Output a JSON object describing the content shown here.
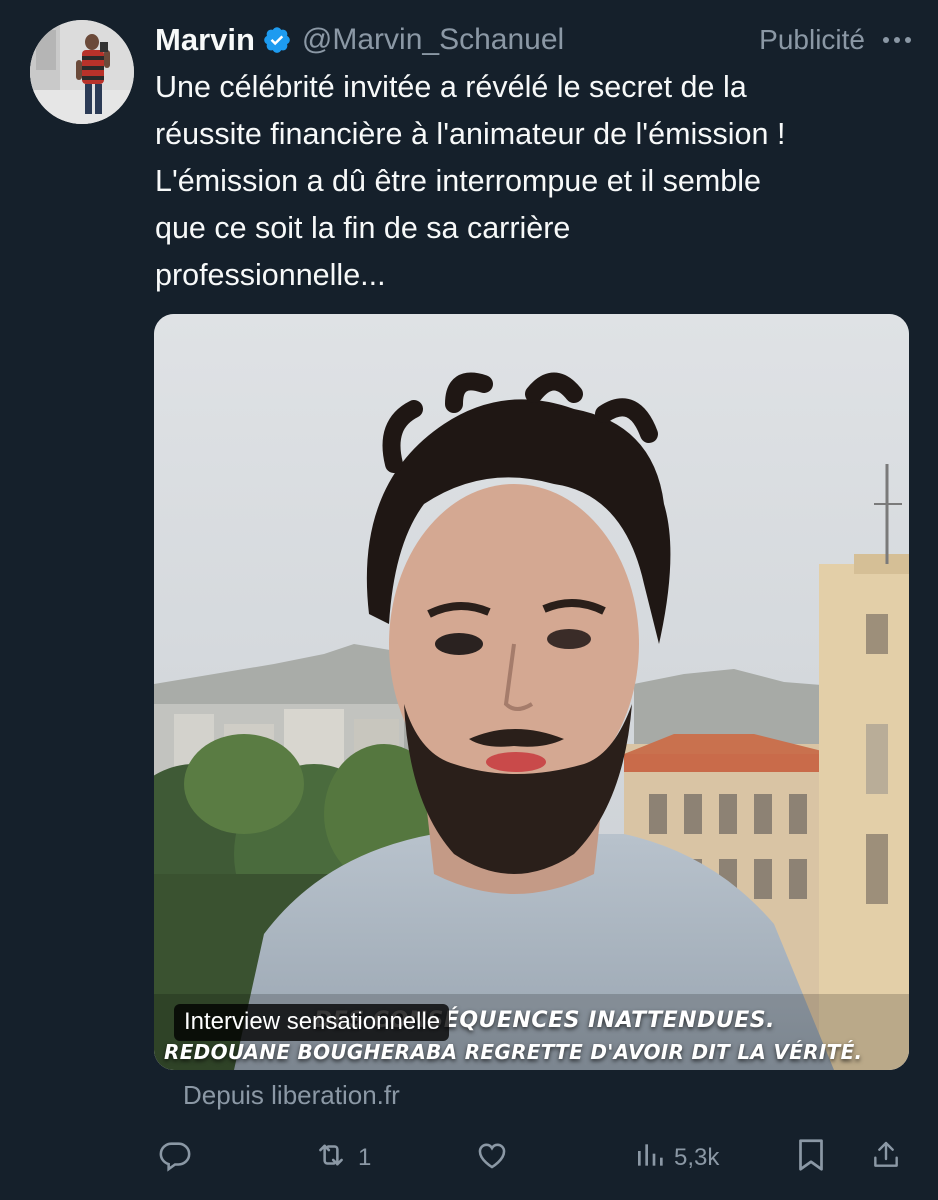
{
  "author": {
    "name": "Marvin",
    "handle": "@Marvin_Schanuel",
    "verified": true
  },
  "promoted_label": "Publicité",
  "tweet_text": "Une célébrité invitée a révélé le secret de la\nréussite financière à l'animateur de l'émission !\nL'émission a dû être interrompue et il semble\nque ce soit la fin de sa carrière\nprofessionnelle...",
  "media": {
    "caption_line1": "DES CONSÉQUENCES INATTENDUES.",
    "caption_line2": "REDOUANE BOUGHERABA REGRETTE D'AVOIR DIT LA VÉRITÉ.",
    "label": "Interview sensationnelle"
  },
  "source": "Depuis liberation.fr",
  "actions": {
    "reply_icon": "reply-icon",
    "retweet_count": "1",
    "like_icon": "heart-icon",
    "views_count": "5,3k",
    "bookmark_icon": "bookmark-icon",
    "share_icon": "share-icon"
  },
  "colors": {
    "background": "#15202b",
    "text_primary": "#f7f9f9",
    "text_secondary": "#8b98a5",
    "verified": "#1d9bf0"
  }
}
